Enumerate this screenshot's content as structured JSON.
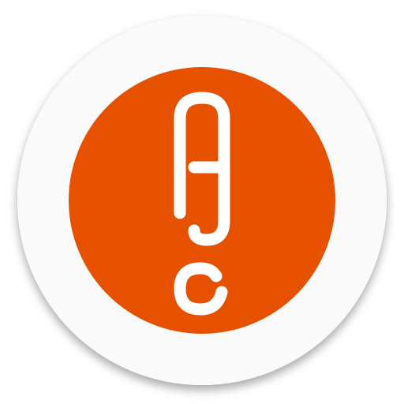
{
  "app_icon": {
    "name": "app-icon",
    "colors": {
      "page_background": "#ffffff",
      "outer_disc": "#fafafa",
      "outer_disc_shadow": "#d9d9d9",
      "inner_disc": "#e65100",
      "monogram_stroke": "#ffffff"
    },
    "monogram_icon": "rounded-line-monogram-icon"
  }
}
